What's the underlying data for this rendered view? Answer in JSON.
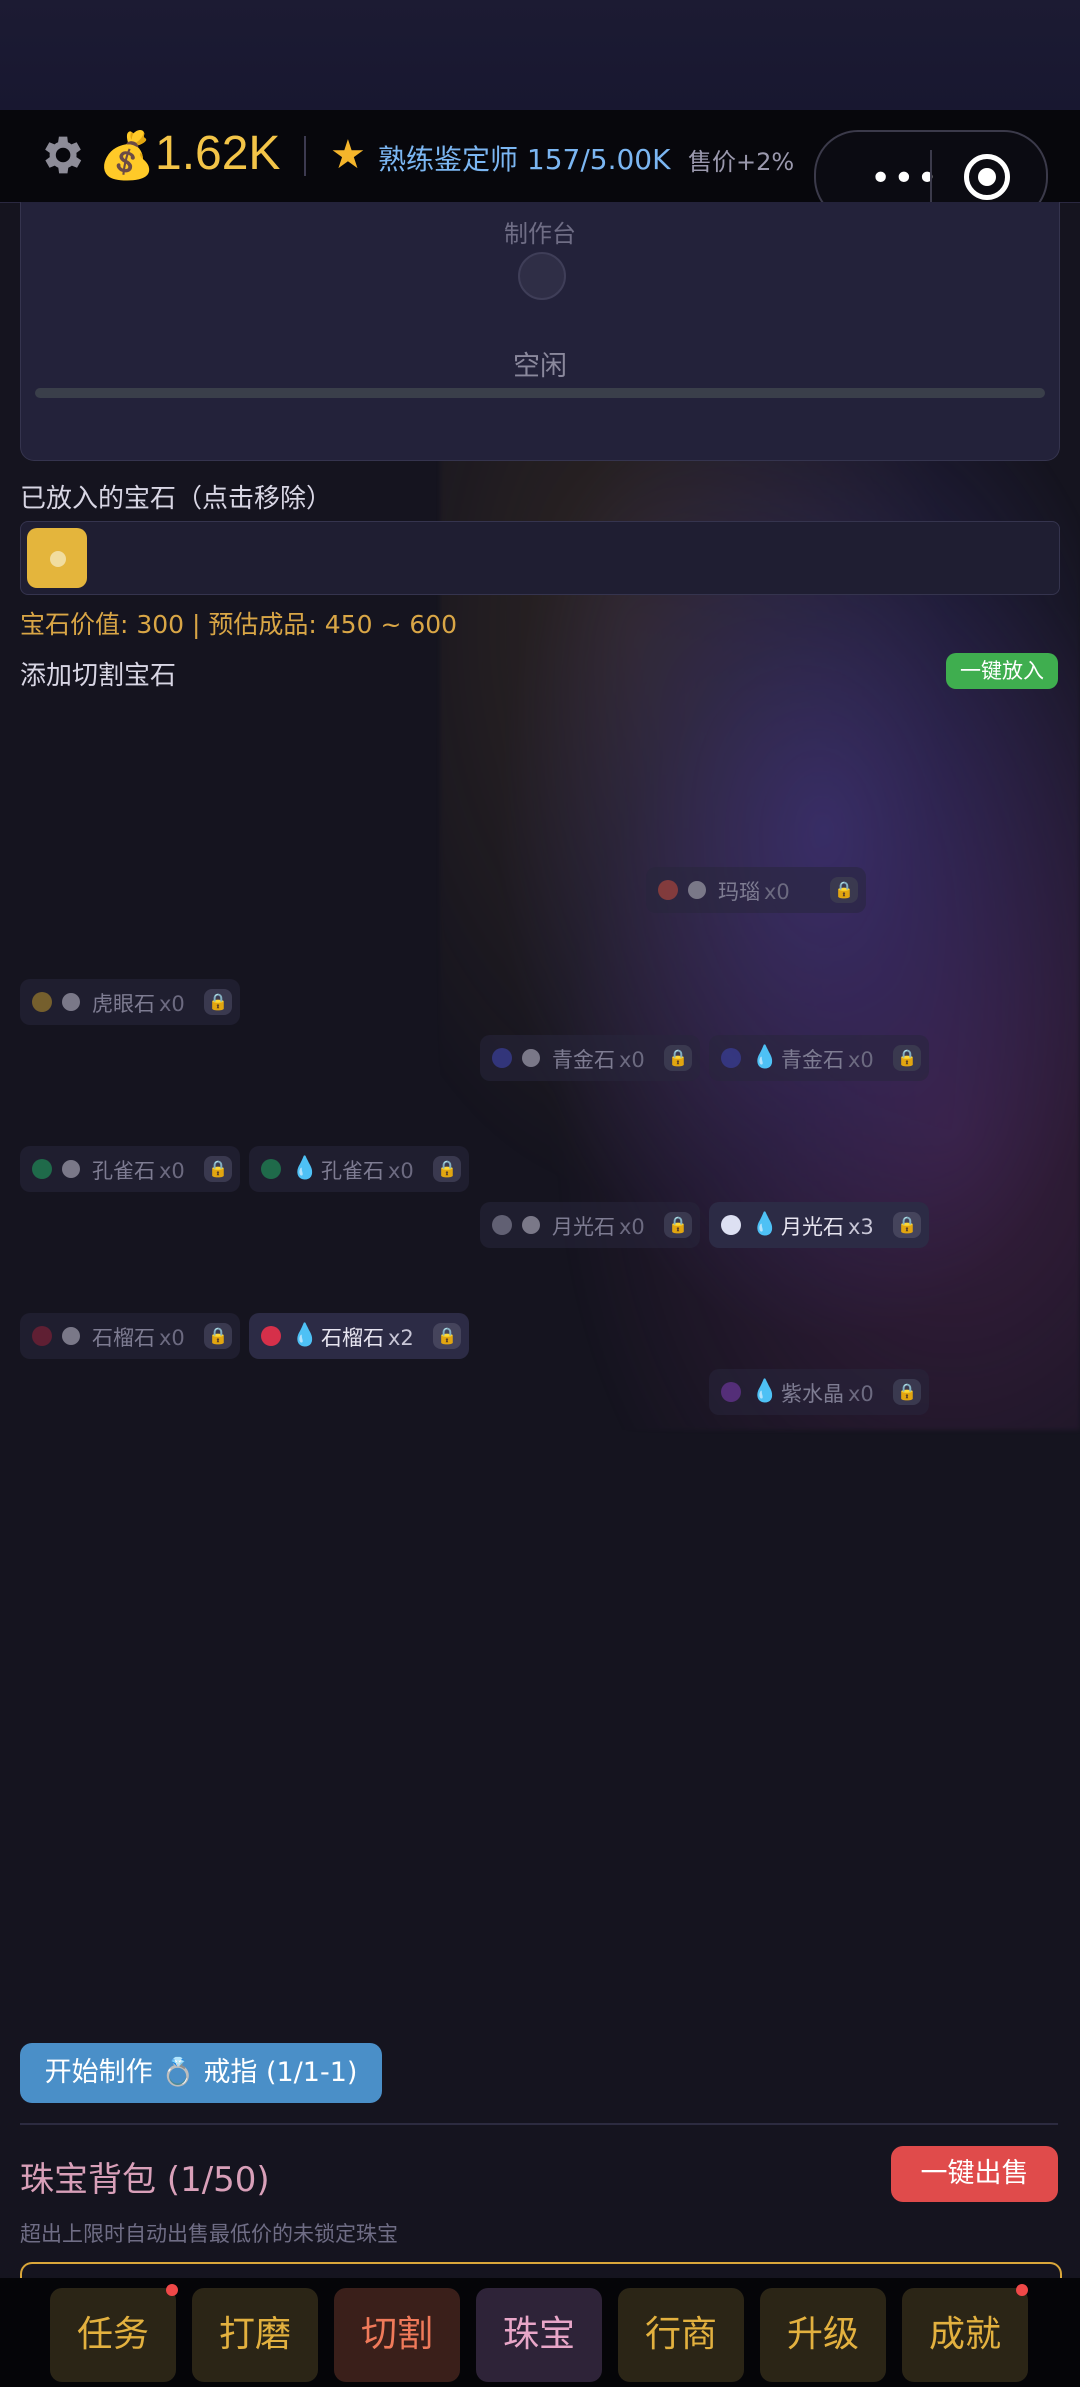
{
  "header": {
    "gear_icon": "gear-icon",
    "money_icon": "money-bag-icon",
    "money": "1.62K",
    "star_icon": "star-icon",
    "rank": "熟练鉴定师 157/5.00K",
    "sale": "售价+2%"
  },
  "capsule": {
    "more_icon": "more-dots-icon",
    "target_icon": "target-icon"
  },
  "workbench": {
    "title": "制作台",
    "status": "空闲",
    "progress": 0
  },
  "placed": {
    "title": "已放入的宝石（点击移除）"
  },
  "value_text": "宝石价值: 300 | 预估成品: 450 ~ 600",
  "add_title": "添加切割宝石",
  "auto_add_label": "一键放入",
  "gems": [
    {
      "name": "玛瑙",
      "count": "x0",
      "color": "#a8453c",
      "type": "dot",
      "owned": false
    },
    {
      "name": "虎眼石",
      "count": "x0",
      "color": "#9a7a2c",
      "type": "dot",
      "owned": false
    },
    {
      "name": "青金石",
      "count": "x0",
      "color": "#3a3f9a",
      "type": "dot",
      "owned": false
    },
    {
      "name": "青金石",
      "count": "x0",
      "color": "#3a3f9a",
      "type": "drop",
      "owned": false
    },
    {
      "name": "孔雀石",
      "count": "x0",
      "color": "#1f8a55",
      "type": "dot",
      "owned": false
    },
    {
      "name": "孔雀石",
      "count": "x0",
      "color": "#1f8a55",
      "type": "drop",
      "owned": false
    },
    {
      "name": "月光石",
      "count": "x0",
      "color": "#7e7c90",
      "type": "dot",
      "owned": false
    },
    {
      "name": "月光石",
      "count": "x3",
      "color": "#dde0f2",
      "type": "drop",
      "owned": true
    },
    {
      "name": "石榴石",
      "count": "x0",
      "color": "#7a2035",
      "type": "dot",
      "owned": false
    },
    {
      "name": "石榴石",
      "count": "x2",
      "color": "#d6304a",
      "type": "drop",
      "owned": true
    },
    {
      "name": "紫水晶",
      "count": "x0",
      "color": "#6a3596",
      "type": "drop",
      "owned": false
    }
  ],
  "start_button": "开始制作 💍 戒指 (1/1-1)",
  "bag": {
    "title": "珠宝背包 (1/50)",
    "sell_all": "一键出售",
    "note": "超出上限时自动出售最低价的未锁定珠宝"
  },
  "tabs": [
    {
      "label": "任务",
      "dot": true
    },
    {
      "label": "打磨",
      "dot": false
    },
    {
      "label": "切割",
      "dot": false
    },
    {
      "label": "珠宝",
      "dot": false
    },
    {
      "label": "行商",
      "dot": false
    },
    {
      "label": "升级",
      "dot": false
    },
    {
      "label": "成就",
      "dot": true
    }
  ]
}
